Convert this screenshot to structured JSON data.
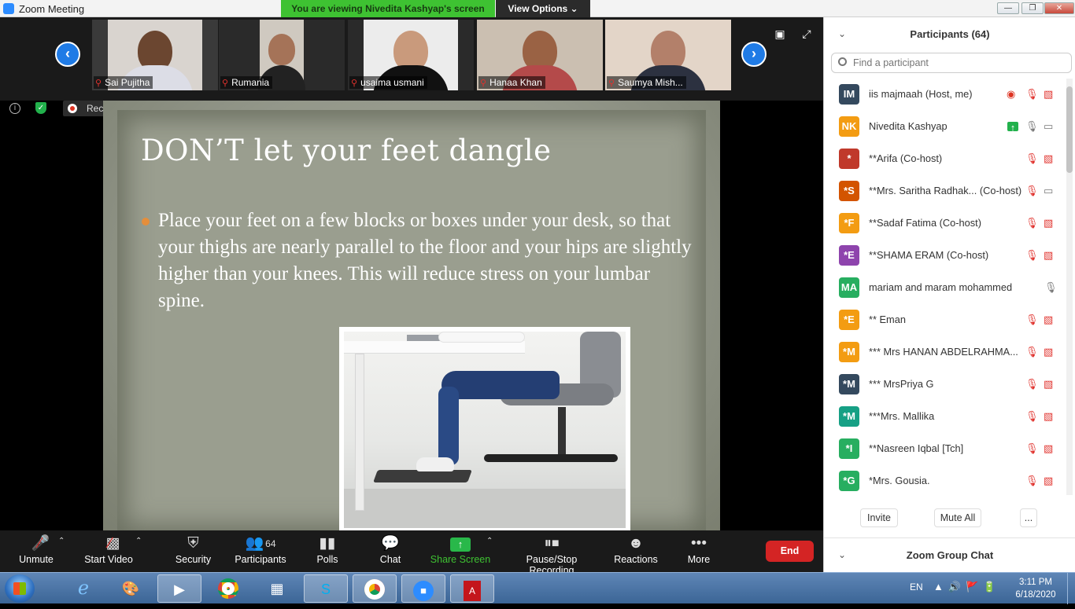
{
  "window": {
    "title": "Zoom Meeting"
  },
  "share_banner": {
    "text": "You are viewing Nivedita Kashyap's screen",
    "view_options": "View Options ⌄"
  },
  "video_tiles": [
    {
      "name": "Sai Pujitha"
    },
    {
      "name": "Rumania"
    },
    {
      "name": "usaima usmani"
    },
    {
      "name": "Hanaa Khan"
    },
    {
      "name": "Saumya Mish..."
    }
  ],
  "recording": {
    "label": "Recording..."
  },
  "slide": {
    "title": "DON’T let your feet dangle",
    "bullet": "Place your feet on a few blocks or boxes under your desk, so that your thighs are nearly parallel to the floor and your hips are slightly higher than your knees. This will reduce stress on your lumbar spine."
  },
  "toolbar": {
    "unmute": "Unmute",
    "start_video": "Start Video",
    "security": "Security",
    "participants": "Participants",
    "participants_count": "64",
    "polls": "Polls",
    "chat": "Chat",
    "share_screen": "Share Screen",
    "pause_stop": "Pause/Stop Recording",
    "reactions": "Reactions",
    "more": "More",
    "end": "End"
  },
  "panel": {
    "title": "Participants (64)",
    "search_placeholder": "Find a participant",
    "participants": [
      {
        "initials": "IM",
        "color": "#34495e",
        "name": "iis majmaah (Host, me)",
        "recording": true,
        "mic": "off",
        "video": "off"
      },
      {
        "initials": "NK",
        "color": "#f39c12",
        "name": "Nivedita Kashyap",
        "sharing": true,
        "mic": "on",
        "video": "on"
      },
      {
        "initials": "*",
        "color": "#c0392b",
        "name": "**Arifa (Co-host)",
        "mic": "off",
        "video": "off"
      },
      {
        "initials": "*S",
        "color": "#d35400",
        "name": "**Mrs. Saritha Radhak... (Co-host)",
        "mic": "off",
        "video": "on"
      },
      {
        "initials": "*F",
        "color": "#f39c12",
        "name": "**Sadaf Fatima (Co-host)",
        "mic": "off",
        "video": "off"
      },
      {
        "initials": "*E",
        "color": "#8e44ad",
        "name": "**SHAMA ERAM (Co-host)",
        "mic": "off",
        "video": "off"
      },
      {
        "initials": "MA",
        "color": "#27ae60",
        "name": "mariam and maram mohammed",
        "mic": "on"
      },
      {
        "initials": "*E",
        "color": "#f39c12",
        "name": "** Eman",
        "mic": "off",
        "video": "off"
      },
      {
        "initials": "*M",
        "color": "#f39c12",
        "name": "*** Mrs HANAN ABDELRAHMA...",
        "mic": "off",
        "video": "off"
      },
      {
        "initials": "*M",
        "color": "#34495e",
        "name": "*** MrsPriya G",
        "mic": "off",
        "video": "off"
      },
      {
        "initials": "*M",
        "color": "#16a085",
        "name": "***Mrs. Mallika",
        "mic": "off",
        "video": "off"
      },
      {
        "initials": "*I",
        "color": "#27ae60",
        "name": "**Nasreen Iqbal [Tch]",
        "mic": "off",
        "video": "off"
      },
      {
        "initials": "*G",
        "color": "#27ae60",
        "name": "*Mrs. Gousia.",
        "mic": "off",
        "video": "off"
      }
    ],
    "invite": "Invite",
    "mute_all": "Mute All",
    "more": "...",
    "chat_title": "Zoom Group Chat"
  },
  "taskbar": {
    "lang": "EN",
    "time": "3:11 PM",
    "date": "6/18/2020"
  }
}
